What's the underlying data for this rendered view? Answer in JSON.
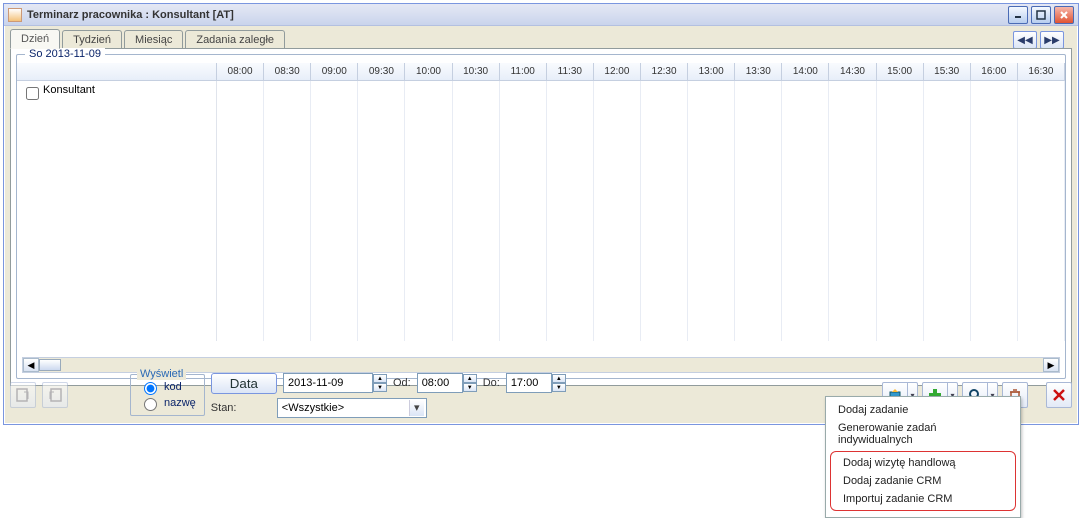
{
  "title": "Terminarz pracownika : Konsultant [AT]",
  "tabs": [
    "Dzień",
    "Tydzień",
    "Miesiąc",
    "Zadania zaległe"
  ],
  "tabs_active_index": 0,
  "date_header": "So  2013-11-09",
  "times": [
    "08:00",
    "08:30",
    "09:00",
    "09:30",
    "10:00",
    "10:30",
    "11:00",
    "11:30",
    "12:00",
    "12:30",
    "13:00",
    "13:30",
    "14:00",
    "14:30",
    "15:00",
    "15:30",
    "16:00",
    "16:30"
  ],
  "row_label": "Konsultant",
  "display": {
    "group_title": "Wyświetl",
    "option_kod": "kod",
    "option_nazwe": "nazwę",
    "selected": "kod"
  },
  "filters": {
    "date_button": "Data",
    "date_value": "2013-11-09",
    "from_label": "Od:",
    "from_value": "08:00",
    "to_label": "Do:",
    "to_value": "17:00",
    "state_label": "Stan:",
    "state_value": "<Wszystkie>"
  },
  "context_menu": {
    "items_top": [
      "Dodaj zadanie",
      "Generowanie zadań indywidualnych"
    ],
    "items_box": [
      "Dodaj wizytę handlową",
      "Dodaj zadanie CRM",
      "Importuj zadanie CRM"
    ]
  },
  "icons": {
    "min": "__",
    "max": "□",
    "close": "✕",
    "prev": "◀◀",
    "next": "▶▶",
    "left": "◀",
    "right": "▶"
  }
}
